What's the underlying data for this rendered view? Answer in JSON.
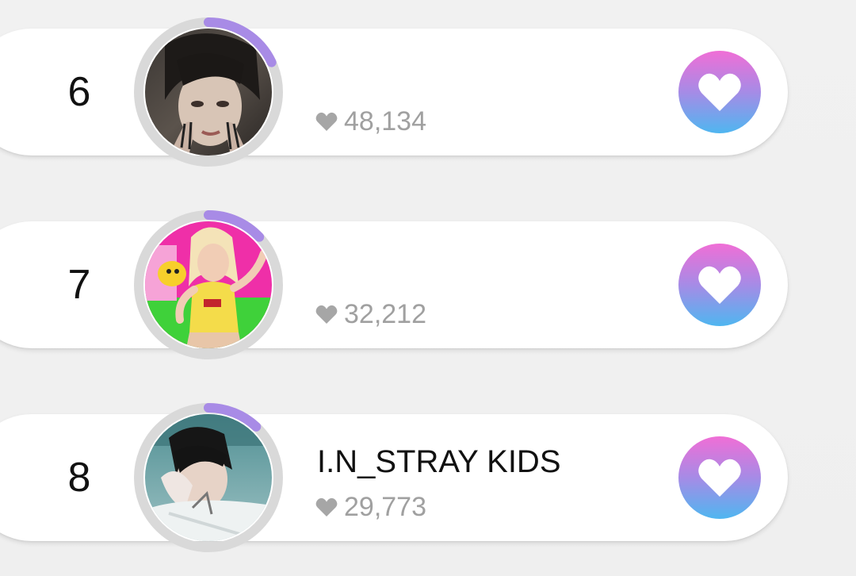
{
  "ranking": {
    "items": [
      {
        "rank": "6",
        "name": "",
        "likes": "48,134",
        "progress": 0.18
      },
      {
        "rank": "7",
        "name": "",
        "likes": "32,212",
        "progress": 0.13
      },
      {
        "rank": "8",
        "name": "I.N_STRAY KIDS",
        "likes": "29,773",
        "progress": 0.12
      }
    ]
  },
  "colors": {
    "progress_arc": "#a88be6",
    "ring": "#d9d9d9",
    "vote_gradient_top": "#f06ed6",
    "vote_gradient_bottom": "#4fb6f0",
    "likes_text": "#a0a0a0"
  },
  "icons": {
    "likes": "heart-icon",
    "vote": "heart-icon"
  }
}
